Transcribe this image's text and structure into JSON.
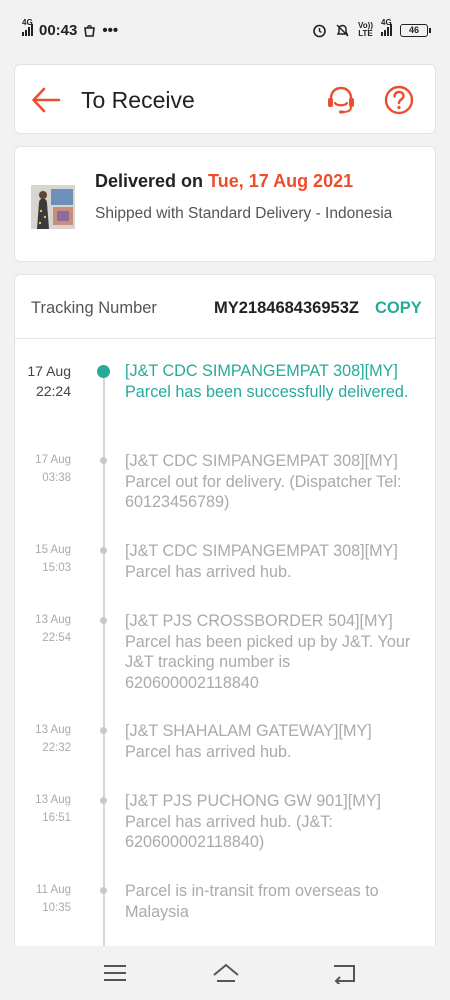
{
  "status_bar": {
    "network": "4G",
    "time": "00:43",
    "overflow": "•••",
    "volte": "Vo))\nLTE",
    "net_right": "4G",
    "battery": "46",
    "icons": [
      "signal-icon",
      "shopee-notification-icon",
      "alarm-icon",
      "mute-icon",
      "volte-icon",
      "signal-icon",
      "battery-icon"
    ]
  },
  "header": {
    "title": "To Receive",
    "icons": [
      "back-arrow-icon",
      "customer-support-icon",
      "help-icon"
    ],
    "accent": "#ee4d2d"
  },
  "delivery": {
    "prefix": "Delivered on ",
    "date": "Tue, 17 Aug 2021",
    "shipped": "Shipped with Standard Delivery - Indonesia"
  },
  "tracking": {
    "label": "Tracking Number",
    "number": "MY218468436953Z",
    "copy": "COPY",
    "accent": "#26aa99"
  },
  "events": [
    {
      "date": "17 Aug",
      "time": "22:24",
      "text": "[J&T CDC SIMPANGEMPAT 308][MY] Parcel has been successfully delivered.",
      "active": true
    },
    {
      "date": "17 Aug",
      "time": "03:38",
      "text": "[J&T CDC SIMPANGEMPAT 308][MY] Parcel out for delivery. (Dispatcher Tel: 60123456789)",
      "active": false
    },
    {
      "date": "15 Aug",
      "time": "15:03",
      "text": "[J&T CDC SIMPANGEMPAT 308][MY] Parcel has arrived hub.",
      "active": false
    },
    {
      "date": "13 Aug",
      "time": "22:54",
      "text": "[J&T PJS CROSSBORDER 504][MY] Parcel has been picked up by J&T. Your J&T tracking number is 620600002118840",
      "active": false
    },
    {
      "date": "13 Aug",
      "time": "22:32",
      "text": "[J&T SHAHALAM GATEWAY][MY] Parcel has arrived hub.",
      "active": false
    },
    {
      "date": "13 Aug",
      "time": "16:51",
      "text": "[J&T PJS PUCHONG GW 901][MY] Parcel has arrived hub. (J&T: 620600002118840)",
      "active": false
    },
    {
      "date": "11 Aug",
      "time": "10:35",
      "text": "Parcel is in-transit from overseas to Malaysia",
      "active": false
    }
  ],
  "nav": {
    "icons": [
      "menu-icon",
      "home-icon",
      "back-icon"
    ]
  }
}
